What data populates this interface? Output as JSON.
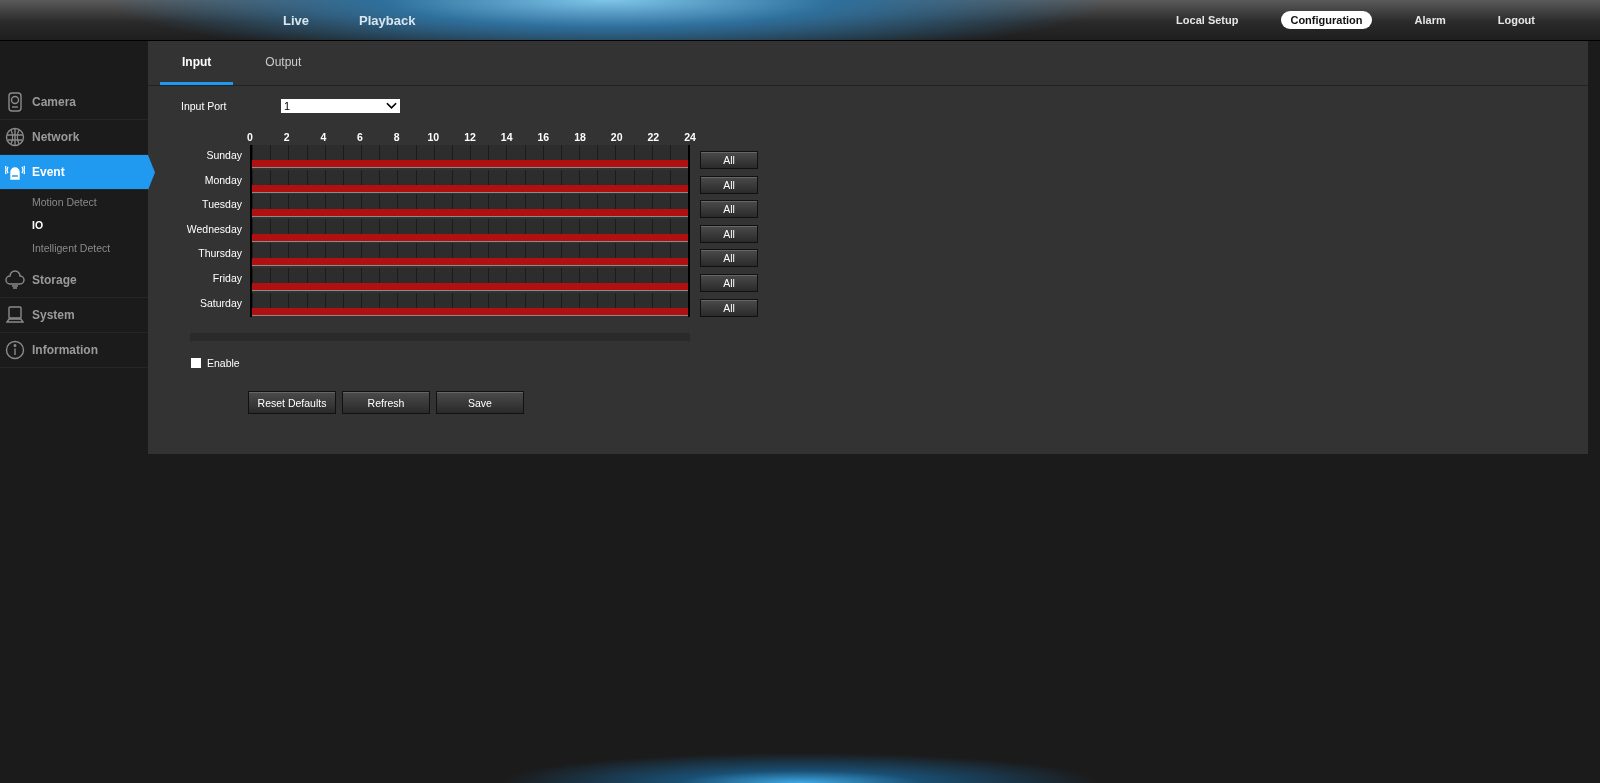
{
  "top_nav": {
    "left": [
      {
        "label": "Live"
      },
      {
        "label": "Playback"
      }
    ],
    "right": [
      {
        "label": "Local Setup",
        "selected": false
      },
      {
        "label": "Configuration",
        "selected": true
      },
      {
        "label": "Alarm",
        "selected": false
      },
      {
        "label": "Logout",
        "selected": false
      }
    ]
  },
  "sidebar": {
    "items": [
      {
        "label": "Camera",
        "kind": "camera",
        "selected": false
      },
      {
        "label": "Network",
        "kind": "network",
        "selected": false
      },
      {
        "label": "Event",
        "kind": "event",
        "selected": true,
        "children": [
          {
            "label": "Motion Detect",
            "selected": false
          },
          {
            "label": "IO",
            "selected": true
          },
          {
            "label": "Intelligent Detect",
            "selected": false
          }
        ]
      },
      {
        "label": "Storage",
        "kind": "storage",
        "selected": false
      },
      {
        "label": "System",
        "kind": "system",
        "selected": false
      },
      {
        "label": "Information",
        "kind": "information",
        "selected": false
      }
    ]
  },
  "tabs": [
    {
      "label": "Input",
      "selected": true
    },
    {
      "label": "Output",
      "selected": false
    }
  ],
  "input_port": {
    "label": "Input Port",
    "value": "1"
  },
  "schedule": {
    "hours": [
      "0",
      "2",
      "4",
      "6",
      "8",
      "10",
      "12",
      "14",
      "16",
      "18",
      "20",
      "22",
      "24"
    ],
    "days": [
      {
        "name": "Sunday",
        "level": 1,
        "button": "All"
      },
      {
        "name": "Monday",
        "level": 1,
        "button": "All"
      },
      {
        "name": "Tuesday",
        "level": 1,
        "button": "All"
      },
      {
        "name": "Wednesday",
        "level": 1,
        "button": "All"
      },
      {
        "name": "Thursday",
        "level": 1,
        "button": "All"
      },
      {
        "name": "Friday",
        "level": 1,
        "button": "All"
      },
      {
        "name": "Saturday",
        "level": 1,
        "button": "All"
      }
    ]
  },
  "enable": {
    "label": "Enable",
    "checked": false
  },
  "buttons": [
    "Reset Defaults",
    "Refresh",
    "Save"
  ]
}
